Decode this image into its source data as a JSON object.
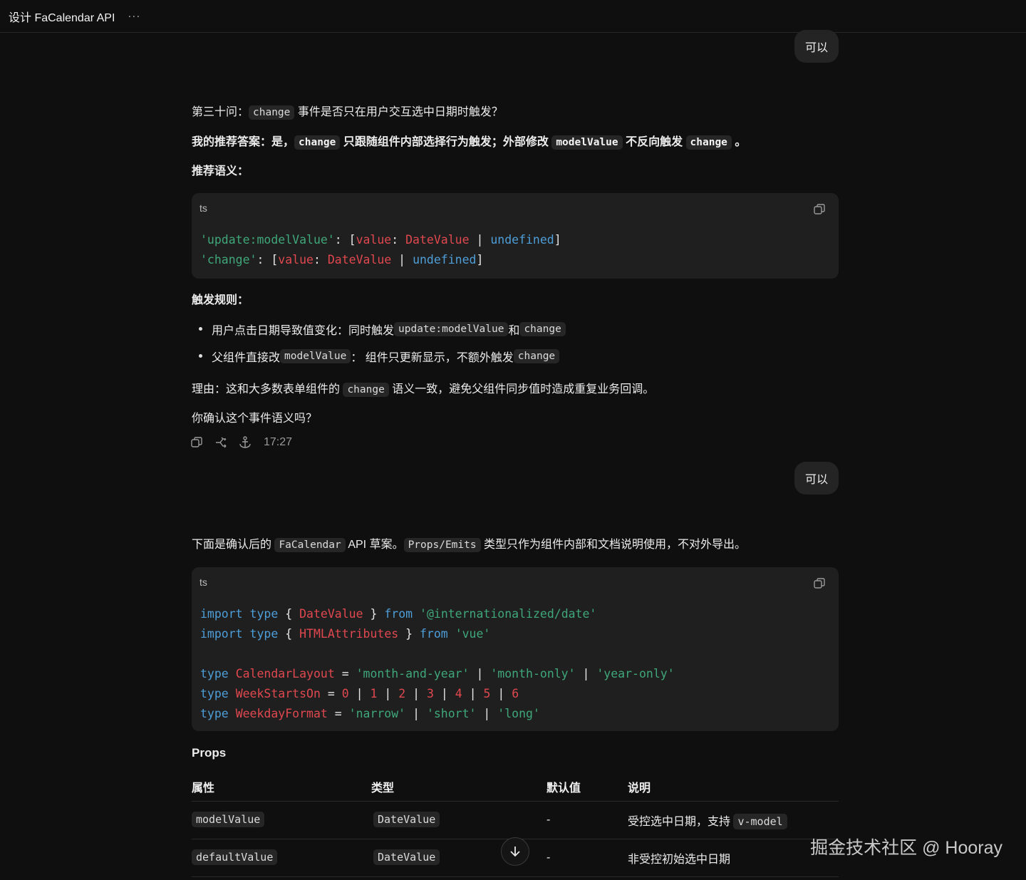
{
  "header": {
    "title": "设计 FaCalendar API",
    "more": "···"
  },
  "bubble1": {
    "text": "可以"
  },
  "msg1": {
    "q_pre": "第三十问：",
    "q_code": "change",
    "q_post": " 事件是否只在用户交互选中日期时触发？",
    "ans_pre": "我的推荐答案：是，",
    "ans_code1": "change",
    "ans_mid1": " 只跟随组件内部选择行为触发；外部修改 ",
    "ans_code2": "modelValue",
    "ans_mid2": " 不反向触发 ",
    "ans_code3": "change",
    "ans_post": " 。",
    "semantics_label": "推荐语义：",
    "code_lang": "ts",
    "rules_label": "触发规则：",
    "rule1_pre": "用户点击日期导致值变化：同时触发 ",
    "rule1_code1": "update:modelValue",
    "rule1_mid": " 和 ",
    "rule1_code2": "change",
    "rule2_pre": "父组件直接改 ",
    "rule2_code1": "modelValue",
    "rule2_mid": "： 组件只更新显示，不额外触发 ",
    "rule2_code2": "change",
    "reason_pre": "理由：这和大多数表单组件的 ",
    "reason_code": "change",
    "reason_post": " 语义一致，避免父组件同步值时造成重复业务回调。",
    "confirm": "你确认这个事件语义吗？",
    "time": "17:27"
  },
  "bubble2": {
    "text": "可以"
  },
  "msg2": {
    "intro_pre": "下面是确认后的 ",
    "intro_code1": "FaCalendar",
    "intro_mid": " API 草案。",
    "intro_code2": "Props/Emits",
    "intro_post": " 类型只作为组件内部和文档说明使用，不对外导出。",
    "code_lang": "ts",
    "props_title": "Props",
    "table_headers": [
      "属性",
      "类型",
      "默认值",
      "说明"
    ],
    "rows": [
      {
        "prop": "modelValue",
        "type": "DateValue",
        "default": "-",
        "desc": "受控选中日期，支持 ",
        "desc_code": "v-model"
      },
      {
        "prop": "defaultValue",
        "type": "DateValue",
        "default": "-",
        "desc": "非受控初始选中日期",
        "desc_code": ""
      }
    ]
  },
  "watermark": "掘金技术社区 @ Hooray"
}
